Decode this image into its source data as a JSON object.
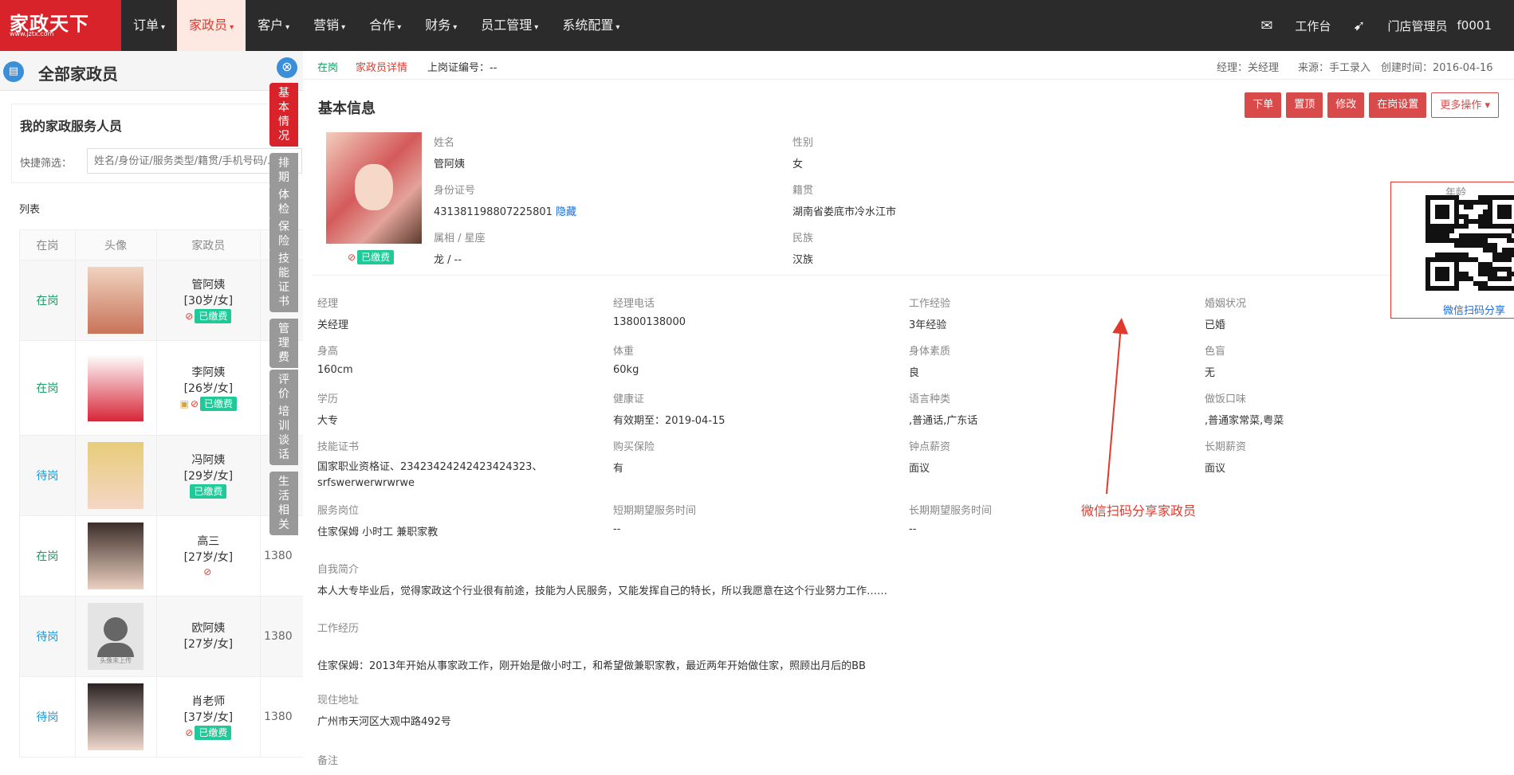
{
  "brand": {
    "name": "家政天下",
    "url": "www.jztx.com"
  },
  "nav": {
    "menus": [
      "订单",
      "家政员",
      "客户",
      "营销",
      "合作",
      "财务",
      "员工管理",
      "系统配置"
    ],
    "active_index": 1,
    "workbench": "工作台",
    "user": "门店管理员",
    "user_id": "f0001",
    "mail_icon": "mail-icon",
    "send_icon": "send-icon"
  },
  "left": {
    "page_title": "全部家政员",
    "section_title": "我的家政服务人员",
    "filter_label": "快捷筛选：",
    "filter_placeholder": "姓名/身份证/服务类型/籍贯/手机号码/…",
    "list_label": "列表",
    "columns": [
      "在岗",
      "头像",
      "家政员"
    ],
    "rows": [
      {
        "status": "在岗",
        "name": "管阿姨",
        "info": "[30岁/女]",
        "fee": "已缴费",
        "phone": ""
      },
      {
        "status": "在岗",
        "name": "李阿姨",
        "info": "[26岁/女]",
        "fee": "已缴费",
        "phone": ""
      },
      {
        "status": "待岗",
        "name": "冯阿姨",
        "info": "[29岁/女]",
        "fee": "已缴费",
        "phone": ""
      },
      {
        "status": "在岗",
        "name": "高三",
        "info": "[27岁/女]",
        "fee": "",
        "phone": "1380"
      },
      {
        "status": "待岗",
        "name": "欧阿姨",
        "info": "[27岁/女]",
        "fee": "",
        "phone": "1380",
        "avatar_text": "头像未上传"
      },
      {
        "status": "待岗",
        "name": "肖老师",
        "info": "[37岁/女]",
        "fee": "已缴费",
        "phone": "1380"
      }
    ]
  },
  "tabs": [
    "基本情况",
    "排期",
    "体检",
    "保险",
    "技能证书",
    "管理费",
    "评价",
    "培训谈话",
    "生活相关"
  ],
  "crumb": {
    "status": "在岗",
    "detail": "家政员详情",
    "cert_no": "上岗证编号：--",
    "manager": "经理：关经理",
    "source": "来源：手工录入",
    "created": "创建时间：2016-04-16"
  },
  "basic": {
    "title": "基本信息",
    "buttons": [
      "下单",
      "置顶",
      "修改",
      "在岗设置",
      "更多操作"
    ],
    "photo_status": "已缴费",
    "name_k": "姓名",
    "name_v": "管阿姨",
    "gender_k": "性别",
    "gender_v": "女",
    "age_k": "年龄",
    "id_k": "身份证号",
    "id_v": "431381198807225801",
    "id_hide": "隐藏",
    "origin_k": "籍贯",
    "origin_v": "湖南省娄底市冷水江市",
    "zodiac_k": "属相 / 星座",
    "zodiac_v": "龙 / --",
    "ethnic_k": "民族",
    "ethnic_v": "汉族",
    "qr_link": "微信扫码分享"
  },
  "details": {
    "manager_k": "经理",
    "manager_v": "关经理",
    "mphone_k": "经理电话",
    "mphone_v": "13800138000",
    "exp_k": "工作经验",
    "exp_v": "3年经验",
    "marriage_k": "婚姻状况",
    "marriage_v": "已婚",
    "height_k": "身高",
    "height_v": "160cm",
    "weight_k": "体重",
    "weight_v": "60kg",
    "health_k": "身体素质",
    "health_v": "良",
    "color_k": "色盲",
    "color_v": "无",
    "edu_k": "学历",
    "edu_v": "大专",
    "hcert_k": "健康证",
    "hcert_v": "有效期至：2019-04-15",
    "lang_k": "语言种类",
    "lang_v": ",普通话,广东话",
    "cook_k": "做饭口味",
    "cook_v": ",普通家常菜,粤菜",
    "skill_k": "技能证书",
    "skill_v1": "国家职业资格证、23423424242423424323、",
    "skill_v2": "srfswerwerwrwrwe",
    "ins_k": "购买保险",
    "ins_v": "有",
    "hour_k": "钟点薪资",
    "hour_v": "面议",
    "long_k": "长期薪资",
    "long_v": "面议",
    "post_k": "服务岗位",
    "post_v": "住家保姆 小时工 兼职家教",
    "short_k": "短期期望服务时间",
    "short_v": "--",
    "longt_k": "长期期望服务时间",
    "longt_v": "--",
    "intro_k": "自我简介",
    "intro_v": "本人大专毕业后，觉得家政这个行业很有前途，技能为人民服务，又能发挥自己的特长，所以我愿意在这个行业努力工作……",
    "work_k": "工作经历",
    "work_v": "住家保姆：2013年开始从事家政工作，刚开始是做小时工，和希望做兼职家教，最近两年开始做住家，照顾出月后的BB",
    "addr_k": "现住地址",
    "addr_v": "广州市天河区大观中路492号",
    "note_k": "备注"
  },
  "annotation": "微信扫码分享家政员",
  "colors": {
    "brand": "#d8232a",
    "nav_bg": "#2b2b2b",
    "active_menu_bg": "#fde8e2",
    "on_duty": "#1a9d64",
    "waiting": "#1a9ad6",
    "paid_badge": "#20c997",
    "button": "#d94a4a"
  }
}
